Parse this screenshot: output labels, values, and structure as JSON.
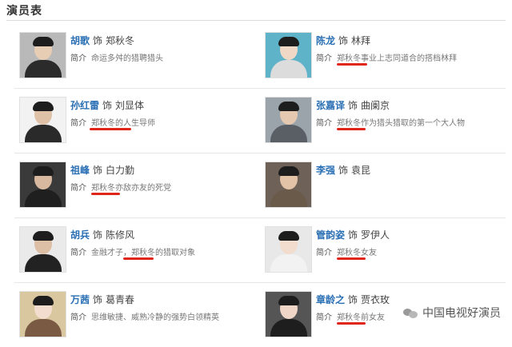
{
  "section_title": "演员表",
  "as_word": "饰",
  "intro_label": "简介",
  "cast": [
    {
      "actor": "胡歌",
      "role": "郑秋冬",
      "intro": "命运多舛的猎聘猎头",
      "underline": false
    },
    {
      "actor": "陈龙",
      "role": "林拜",
      "intro": "郑秋冬事业上志同道合的搭档林拜",
      "underline": true
    },
    {
      "actor": "孙红雷",
      "role": "刘显体",
      "intro": "郑秋冬的人生导师",
      "underline": true
    },
    {
      "actor": "张嘉译",
      "role": "曲阑京",
      "intro": "郑秋冬作为猎头猎取的第一个大人物",
      "underline": true
    },
    {
      "actor": "祖峰",
      "role": "白力勤",
      "intro": "郑秋冬亦敌亦友的死党",
      "underline": true
    },
    {
      "actor": "李强",
      "role": "袁昆",
      "intro": "",
      "underline": false
    },
    {
      "actor": "胡兵",
      "role": "陈修风",
      "intro": "金融才子，郑秋冬的猎取对象",
      "underline": true
    },
    {
      "actor": "管韵姿",
      "role": "罗伊人",
      "intro": "郑秋冬女友",
      "underline": true
    },
    {
      "actor": "万茜",
      "role": "葛青春",
      "intro": "思维敏捷、威熟冷静的强势白领精英",
      "underline": false
    },
    {
      "actor": "章龄之",
      "role": "贾衣玫",
      "intro": "郑秋冬前女友",
      "underline": true
    }
  ],
  "watermark": "中国电视好演员"
}
